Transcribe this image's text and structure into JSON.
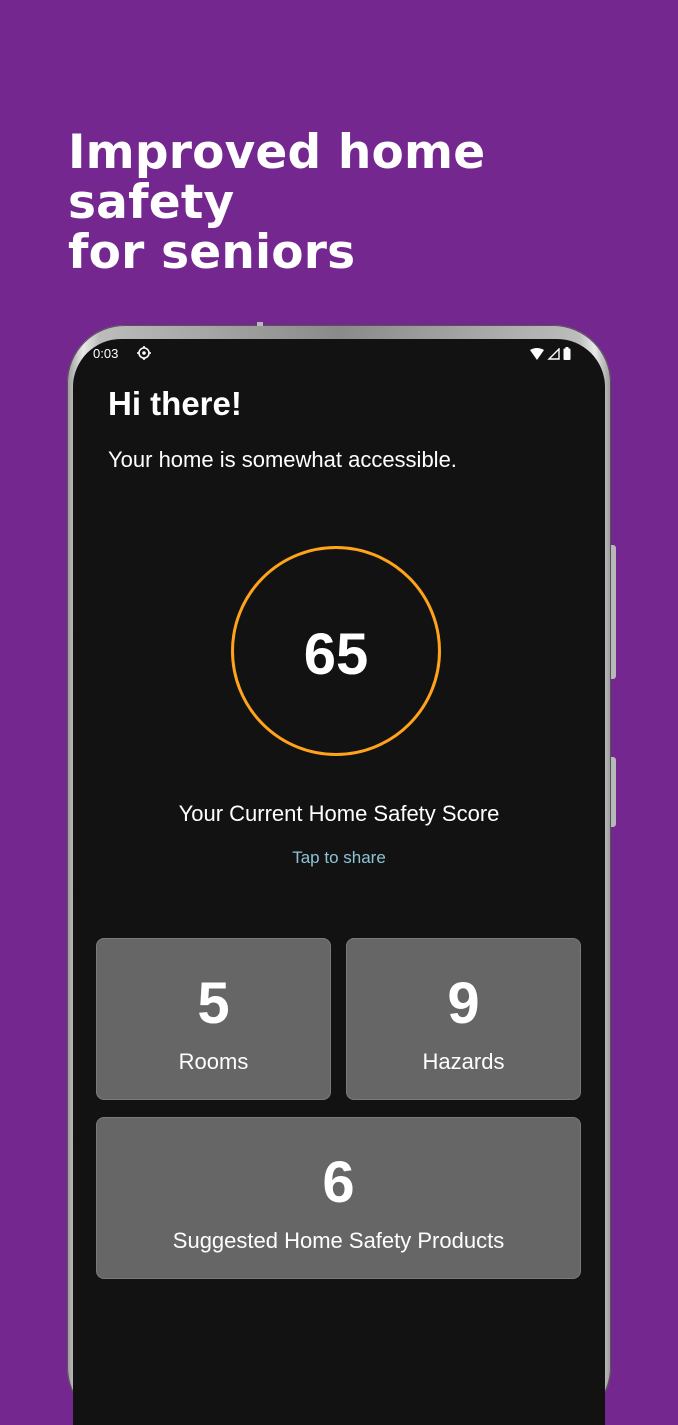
{
  "headline": {
    "line1": "Improved home safety",
    "line2": "for seniors"
  },
  "statusbar": {
    "time": "0:03"
  },
  "home": {
    "greeting": "Hi there!",
    "status_text": "Your home is somewhat accessible.",
    "score": "65",
    "score_label": "Your Current Home Safety Score",
    "share_label": "Tap to share"
  },
  "stats": {
    "rooms": {
      "value": "5",
      "label": "Rooms"
    },
    "hazards": {
      "value": "9",
      "label": "Hazards"
    },
    "products": {
      "value": "6",
      "label": "Suggested Home Safety Products"
    }
  },
  "colors": {
    "background": "#74288f",
    "screen": "#121212",
    "score_ring": "#ffa31a",
    "card": "#666666",
    "link": "#8ec3d6"
  }
}
